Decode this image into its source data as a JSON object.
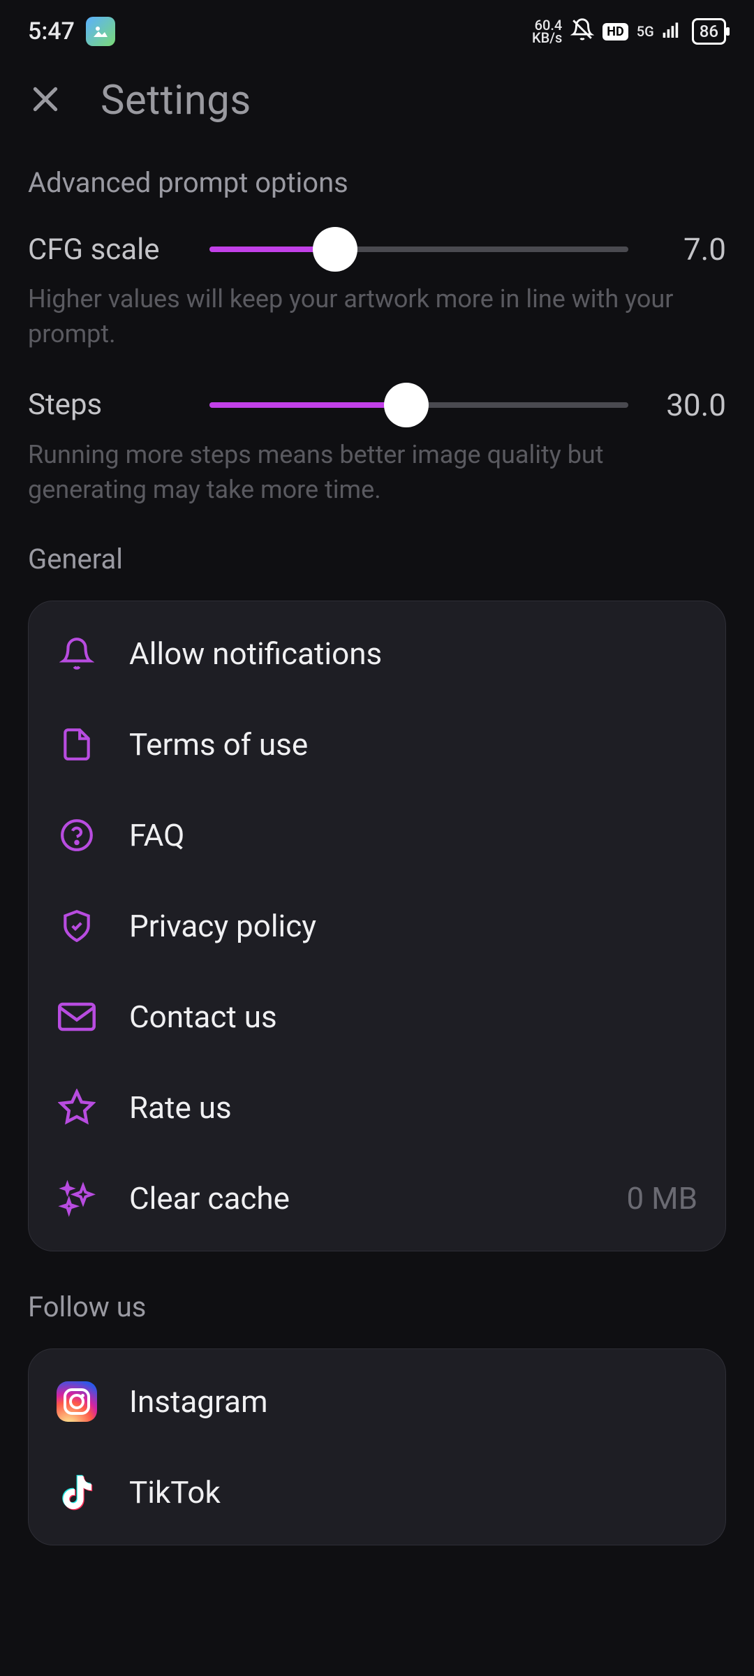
{
  "status": {
    "time": "5:47",
    "speed_val": "60.4",
    "speed_unit": "KB/s",
    "net": "5G",
    "battery": "86"
  },
  "header": {
    "title": "Settings"
  },
  "advanced": {
    "label": "Advanced prompt options",
    "cfg": {
      "label": "CFG scale",
      "value": "7.0",
      "percent": 30,
      "hint": "Higher values will keep your artwork more in line with your prompt."
    },
    "steps": {
      "label": "Steps",
      "value": "30.0",
      "percent": 47,
      "hint": "Running more steps means better image quality but generating may take more time."
    }
  },
  "general": {
    "label": "General",
    "items": {
      "notifications": "Allow notifications",
      "terms": "Terms of use",
      "faq": "FAQ",
      "privacy": "Privacy policy",
      "contact": "Contact us",
      "rate": "Rate us",
      "clear": "Clear cache",
      "clear_size": "0 MB"
    }
  },
  "follow": {
    "label": "Follow us",
    "instagram": "Instagram",
    "tiktok": "TikTok"
  }
}
